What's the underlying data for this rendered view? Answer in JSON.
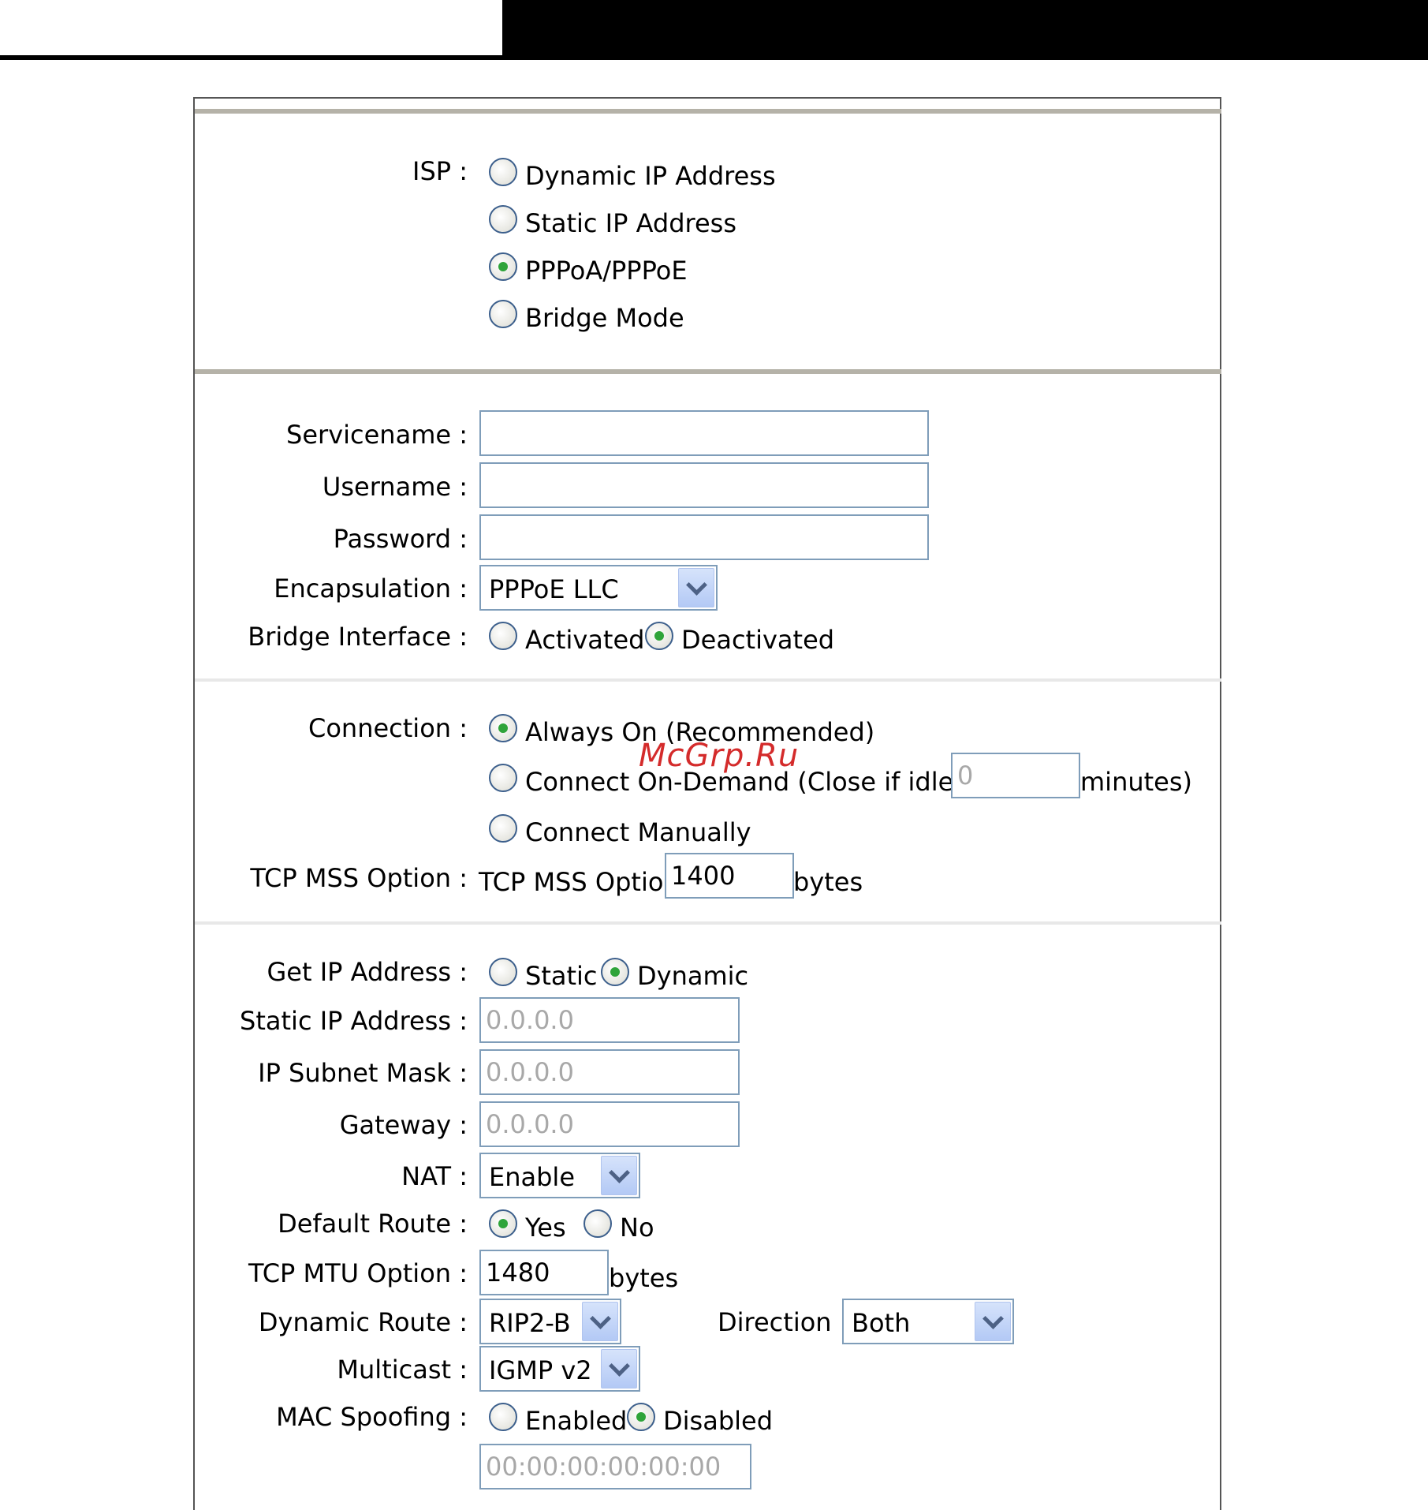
{
  "isp": {
    "label": "ISP :",
    "options": [
      "Dynamic IP Address",
      "Static IP Address",
      "PPPoA/PPPoE",
      "Bridge Mode"
    ],
    "selected": "PPPoA/PPPoE"
  },
  "pppoe": {
    "servicename_label": "Servicename :",
    "servicename_value": "",
    "username_label": "Username :",
    "username_value": "",
    "password_label": "Password :",
    "password_value": "",
    "encapsulation_label": "Encapsulation :",
    "encapsulation_value": "PPPoE LLC",
    "bridge_label": "Bridge Interface :",
    "bridge_options": [
      "Activated",
      "Deactivated"
    ],
    "bridge_selected": "Deactivated"
  },
  "connection": {
    "label": "Connection :",
    "always_on": "Always On (Recommended)",
    "on_demand": "Connect On-Demand (Close if idle for",
    "idle_value": "0",
    "minutes": "minutes)",
    "manual": "Connect Manually",
    "selected": "Always On (Recommended)",
    "mss_label": "TCP MSS Option :",
    "mss_prefix": "TCP MSS Option",
    "mss_value": "1400",
    "mss_unit": "bytes"
  },
  "ip": {
    "get_label": "Get IP Address :",
    "get_options": [
      "Static",
      "Dynamic"
    ],
    "get_selected": "Dynamic",
    "static_label": "Static IP Address :",
    "static_value": "0.0.0.0",
    "mask_label": "IP Subnet Mask :",
    "mask_value": "0.0.0.0",
    "gateway_label": "Gateway :",
    "gateway_value": "0.0.0.0",
    "nat_label": "NAT :",
    "nat_value": "Enable",
    "default_route_label": "Default Route :",
    "default_route_options": [
      "Yes",
      "No"
    ],
    "default_route_selected": "Yes",
    "mtu_label": "TCP MTU Option :",
    "mtu_value": "1480",
    "mtu_unit": "bytes",
    "dynamic_route_label": "Dynamic Route :",
    "dynamic_route_value": "RIP2-B",
    "direction_label": "Direction :",
    "direction_value": "Both",
    "multicast_label": "Multicast :",
    "multicast_value": "IGMP v2",
    "mac_label": "MAC Spoofing :",
    "mac_options": [
      "Enabled",
      "Disabled"
    ],
    "mac_selected": "Disabled",
    "mac_value": "00:00:00:00:00:00"
  },
  "watermark": "McGrp.Ru"
}
